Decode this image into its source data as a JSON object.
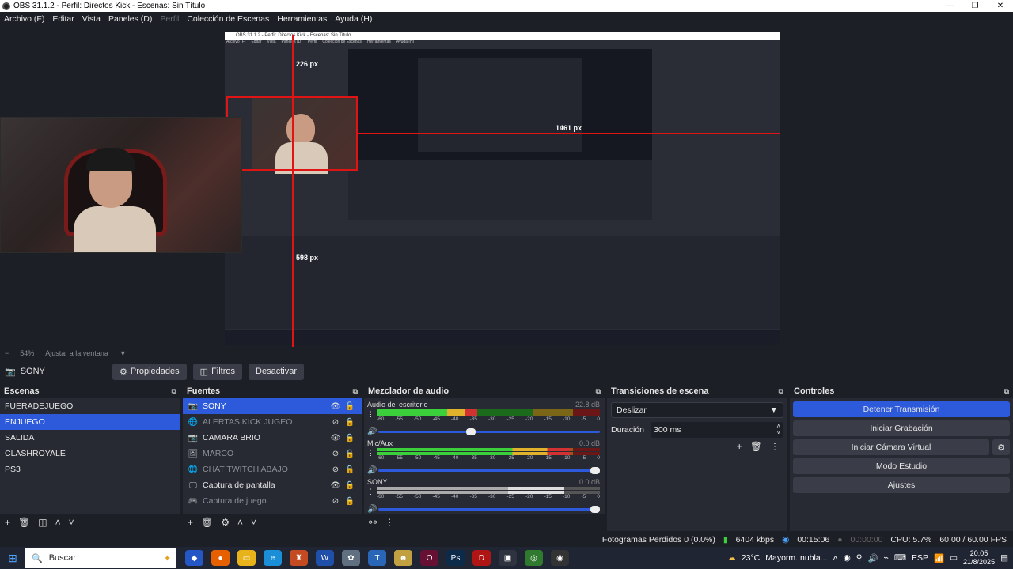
{
  "window": {
    "title": "OBS 31.1.2 - Perfil: Directos Kick - Escenas: Sin Título"
  },
  "menu": [
    {
      "label": "Archivo (F)",
      "disabled": false
    },
    {
      "label": "Editar",
      "disabled": false
    },
    {
      "label": "Vista",
      "disabled": false
    },
    {
      "label": "Paneles (D)",
      "disabled": false
    },
    {
      "label": "Perfil",
      "disabled": true
    },
    {
      "label": "Colección de Escenas",
      "disabled": false
    },
    {
      "label": "Herramientas",
      "disabled": false
    },
    {
      "label": "Ayuda (H)",
      "disabled": false
    }
  ],
  "preview": {
    "measure_top": "226 px",
    "measure_right": "1461 px",
    "measure_bottom": "598 px"
  },
  "zoom": {
    "value": "54%",
    "fit_label": "Ajustar a la ventana"
  },
  "source_bar": {
    "selected_source": "SONY",
    "properties": "Propiedades",
    "filters": "Filtros",
    "deactivate": "Desactivar"
  },
  "scenes": {
    "title": "Escenas",
    "items": [
      "FUERADEJUEGO",
      "ENJUEGO",
      "SALIDA",
      "CLASHROYALE",
      "PS3"
    ],
    "selected": "ENJUEGO"
  },
  "sources": {
    "title": "Fuentes",
    "items": [
      {
        "label": "SONY",
        "icon": "camera-icon",
        "visible": true,
        "locked": false,
        "selected": true
      },
      {
        "label": "ALERTAS KICK JUGEO",
        "icon": "globe-icon",
        "visible": false,
        "locked": true,
        "selected": false
      },
      {
        "label": "CAMARA BRIO",
        "icon": "camera-icon",
        "visible": true,
        "locked": true,
        "selected": false
      },
      {
        "label": "MARCO",
        "icon": "image-icon",
        "visible": false,
        "locked": true,
        "selected": false
      },
      {
        "label": "CHAT TWITCH ABAJO",
        "icon": "globe-icon",
        "visible": false,
        "locked": true,
        "selected": false
      },
      {
        "label": "Captura de pantalla",
        "icon": "monitor-icon",
        "visible": true,
        "locked": true,
        "selected": false
      },
      {
        "label": "Captura de juego",
        "icon": "gamepad-icon",
        "visible": false,
        "locked": true,
        "selected": false
      }
    ]
  },
  "mixer": {
    "title": "Mezclador de audio",
    "ticks": [
      "-60",
      "-55",
      "-50",
      "-45",
      "-40",
      "-35",
      "-30",
      "-25",
      "-20",
      "-15",
      "-10",
      "-5",
      "0"
    ],
    "channels": [
      {
        "name": "Audio del escritorio",
        "db": "-22.8 dB",
        "level": 0.45,
        "volume": 0.44,
        "active": true
      },
      {
        "name": "Mic/Aux",
        "db": "0.0 dB",
        "level": 0.87,
        "volume": 1.0,
        "active": true
      },
      {
        "name": "SONY",
        "db": "0.0 dB",
        "level": 0.84,
        "volume": 1.0,
        "active": false
      }
    ]
  },
  "transitions": {
    "title": "Transiciones de escena",
    "type": "Deslizar",
    "duration_label": "Duración",
    "duration": "300 ms"
  },
  "controls": {
    "title": "Controles",
    "stop_stream": "Detener Transmisión",
    "start_record": "Iniciar Grabación",
    "virtual_cam": "Iniciar Cámara Virtual",
    "studio_mode": "Modo Estudio",
    "settings": "Ajustes"
  },
  "status": {
    "dropped": "Fotogramas Perdidos 0 (0.0%)",
    "bitrate": "6404 kbps",
    "stream_time": "00:15:06",
    "rec_time": "00:00:00",
    "cpu": "CPU: 5.7%",
    "fps": "60.00 / 60.00 FPS"
  },
  "taskbar": {
    "search": "Buscar",
    "weather": "23°C",
    "weather_desc": "Mayorm. nubla...",
    "lang": "ESP",
    "time": "20:05",
    "date": "21/8/2025"
  },
  "colors": {
    "accent": "#2d5adb",
    "meter_green": "#3ccf3c",
    "meter_yellow": "#e0b12a",
    "meter_red": "#d23232",
    "guide_red": "#e01414"
  }
}
